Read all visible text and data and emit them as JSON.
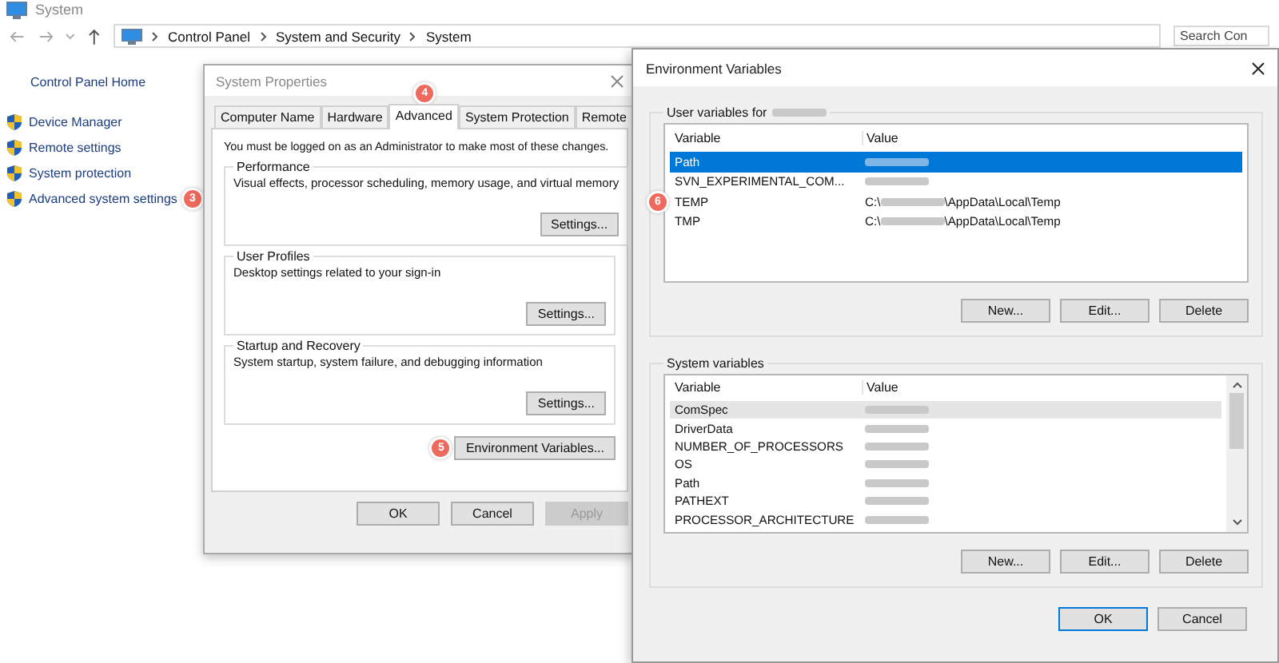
{
  "system_window": {
    "title": "System",
    "breadcrumb": [
      "Control Panel",
      "System and Security",
      "System"
    ],
    "search": {
      "placeholder": "Search Con"
    },
    "sidebar": {
      "home": "Control Panel Home",
      "items": [
        {
          "label": "Device Manager"
        },
        {
          "label": "Remote settings"
        },
        {
          "label": "System protection"
        },
        {
          "label": "Advanced system settings",
          "callout": "3"
        }
      ]
    }
  },
  "system_properties": {
    "title": "System Properties",
    "tabs": [
      {
        "label": "Computer Name",
        "selected": false
      },
      {
        "label": "Hardware",
        "selected": false
      },
      {
        "label": "Advanced",
        "selected": true,
        "callout": "4"
      },
      {
        "label": "System Protection",
        "selected": false
      },
      {
        "label": "Remote",
        "selected": false
      }
    ],
    "notice": "You must be logged on as an Administrator to make most of these changes.",
    "groups": [
      {
        "title": "Performance",
        "description": "Visual effects, processor scheduling, memory usage, and virtual memory",
        "button": "Settings..."
      },
      {
        "title": "User Profiles",
        "description": "Desktop settings related to your sign-in",
        "button": "Settings..."
      },
      {
        "title": "Startup and Recovery",
        "description": "System startup, system failure, and debugging information",
        "button": "Settings..."
      }
    ],
    "env_button": {
      "label": "Environment Variables...",
      "callout": "5"
    },
    "buttons": [
      {
        "label": "OK",
        "disabled": false
      },
      {
        "label": "Cancel",
        "disabled": false
      },
      {
        "label": "Apply",
        "disabled": true
      }
    ]
  },
  "environment_variables": {
    "title": "Environment Variables",
    "groups": [
      {
        "title": "User variables for",
        "title_redacted": true,
        "focused": true,
        "scrollbar": false,
        "columns": [
          "Variable",
          "Value"
        ],
        "rows": [
          {
            "variable": "Path",
            "selected": true,
            "value": [
              {
                "kind": "redacted"
              }
            ]
          },
          {
            "variable": "SVN_EXPERIMENTAL_COM...",
            "selected": false,
            "value": [
              {
                "kind": "redacted"
              }
            ]
          },
          {
            "variable": "TEMP",
            "selected": false,
            "callout": "6",
            "value": [
              {
                "kind": "text",
                "text": "C:\\"
              },
              {
                "kind": "redacted"
              },
              {
                "kind": "text",
                "text": "\\AppData\\Local\\Temp"
              }
            ]
          },
          {
            "variable": "TMP",
            "selected": false,
            "value": [
              {
                "kind": "text",
                "text": "C:\\"
              },
              {
                "kind": "redacted"
              },
              {
                "kind": "text",
                "text": "\\AppData\\Local\\Temp"
              }
            ]
          }
        ],
        "buttons": [
          "New...",
          "Edit...",
          "Delete"
        ]
      },
      {
        "title": "System variables",
        "title_redacted": false,
        "focused": false,
        "scrollbar": true,
        "columns": [
          "Variable",
          "Value"
        ],
        "rows": [
          {
            "variable": "ComSpec",
            "selected": true,
            "value": [
              {
                "kind": "redacted"
              }
            ]
          },
          {
            "variable": "DriverData",
            "selected": false,
            "value": [
              {
                "kind": "redacted"
              }
            ]
          },
          {
            "variable": "NUMBER_OF_PROCESSORS",
            "selected": false,
            "value": [
              {
                "kind": "redacted"
              }
            ]
          },
          {
            "variable": "OS",
            "selected": false,
            "value": [
              {
                "kind": "redacted"
              }
            ]
          },
          {
            "variable": "Path",
            "selected": false,
            "value": [
              {
                "kind": "redacted"
              }
            ]
          },
          {
            "variable": "PATHEXT",
            "selected": false,
            "value": [
              {
                "kind": "redacted"
              }
            ]
          },
          {
            "variable": "PROCESSOR_ARCHITECTURE",
            "selected": false,
            "value": [
              {
                "kind": "redacted"
              }
            ]
          }
        ],
        "buttons": [
          "New...",
          "Edit...",
          "Delete"
        ]
      }
    ],
    "buttons": [
      {
        "label": "OK",
        "default": true
      },
      {
        "label": "Cancel",
        "default": false
      }
    ]
  }
}
